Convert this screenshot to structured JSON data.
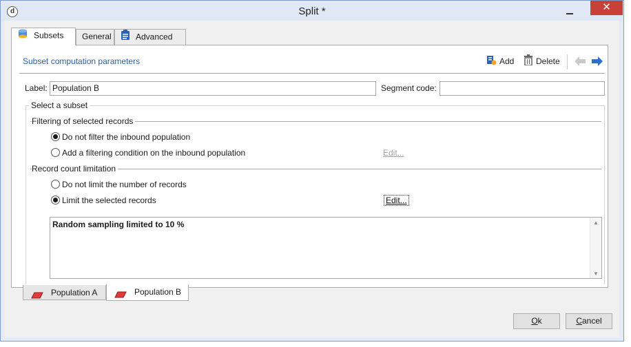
{
  "window": {
    "title": "Split *",
    "close_glyph": "✕",
    "app_icon_letter": "d"
  },
  "tabs": [
    {
      "label": "Subsets",
      "icon": "database-icon"
    },
    {
      "label": "General"
    },
    {
      "label": "Advanced",
      "icon": "clipboard-icon"
    }
  ],
  "toolbar": {
    "title": "Subset computation parameters",
    "add_label": "Add",
    "delete_label": "Delete"
  },
  "fields": {
    "label_label": "Label:",
    "label_value": "Population B",
    "segment_label": "Segment code:",
    "segment_value": ""
  },
  "subset": {
    "group_title": "Select a subset",
    "filtering": {
      "heading": "Filtering of selected records",
      "option_none": "Do not filter the inbound population",
      "option_condition": "Add a filtering condition on the inbound population",
      "edit_label": "Edit...",
      "selected": "none"
    },
    "count": {
      "heading": "Record count limitation",
      "option_none": "Do not limit the number of records",
      "option_limit": "Limit the selected records",
      "edit_label": "Edit...",
      "selected": "limit"
    },
    "summary": "Random sampling limited to 10 %"
  },
  "bottom_tabs": [
    {
      "label": "Population A",
      "icon": "segment-icon"
    },
    {
      "label": "Population B",
      "icon": "segment-icon",
      "active": true
    }
  ],
  "buttons": {
    "ok_mnemonic": "O",
    "ok_rest": "k",
    "cancel_mnemonic": "C",
    "cancel_rest": "ancel"
  }
}
